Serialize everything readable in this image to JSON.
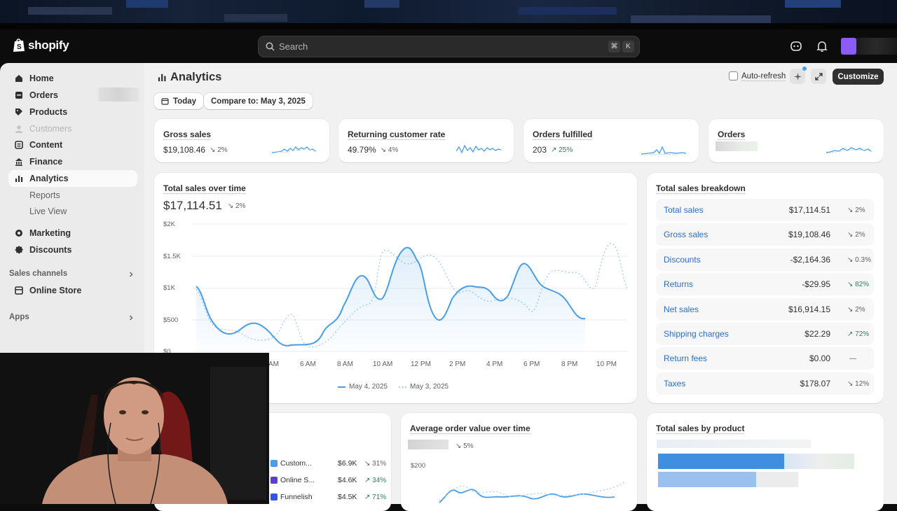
{
  "topbar": {
    "brand": "shopify",
    "search_placeholder": "Search",
    "shortcut_key1": "⌘",
    "shortcut_key2": "K"
  },
  "sidebar": {
    "items": [
      {
        "label": "Home",
        "icon": "home-icon"
      },
      {
        "label": "Orders",
        "icon": "orders-icon"
      },
      {
        "label": "Products",
        "icon": "products-icon"
      },
      {
        "label": "Customers",
        "icon": "customers-icon"
      },
      {
        "label": "Content",
        "icon": "content-icon"
      },
      {
        "label": "Finance",
        "icon": "finance-icon"
      },
      {
        "label": "Analytics",
        "icon": "analytics-icon"
      },
      {
        "label": "Reports"
      },
      {
        "label": "Live View"
      },
      {
        "label": "Marketing",
        "icon": "marketing-icon"
      },
      {
        "label": "Discounts",
        "icon": "discounts-icon"
      }
    ],
    "sales_channels_label": "Sales channels",
    "online_store_label": "Online Store",
    "apps_label": "Apps"
  },
  "header": {
    "title": "Analytics",
    "auto_refresh_label": "Auto-refresh",
    "customize_label": "Customize"
  },
  "filters": {
    "date_label": "Today",
    "compare_label": "Compare to: May 3, 2025"
  },
  "kpis": [
    {
      "title": "Gross sales",
      "value": "$19,108.46",
      "change": "2%",
      "direction": "down"
    },
    {
      "title": "Returning customer rate",
      "value": "49.79%",
      "change": "4%",
      "direction": "down"
    },
    {
      "title": "Orders fulfilled",
      "value": "203",
      "change": "25%",
      "direction": "up"
    },
    {
      "title": "Orders",
      "value": "",
      "change": "",
      "direction": ""
    }
  ],
  "sales_over_time": {
    "title": "Total sales over time",
    "value": "$17,114.51",
    "change": "2%",
    "legend_current": "May 4, 2025",
    "legend_previous": "May 3, 2025",
    "x_ticks": [
      "AM",
      "6 AM",
      "8 AM",
      "10 AM",
      "12 PM",
      "2 PM",
      "4 PM",
      "6 PM",
      "8 PM",
      "10 PM"
    ],
    "y_ticks": [
      "$2K",
      "$1.5K",
      "$1K",
      "$500",
      "$0"
    ]
  },
  "breakdown": {
    "title": "Total sales breakdown",
    "rows": [
      {
        "label": "Total sales",
        "amount": "$17,114.51",
        "change": "2%",
        "direction": "down"
      },
      {
        "label": "Gross sales",
        "amount": "$19,108.46",
        "change": "2%",
        "direction": "down"
      },
      {
        "label": "Discounts",
        "amount": "-$2,164.36",
        "change": "0.3%",
        "direction": "down"
      },
      {
        "label": "Returns",
        "amount": "-$29.95",
        "change": "82%",
        "direction": "down-good"
      },
      {
        "label": "Net sales",
        "amount": "$16,914.15",
        "change": "2%",
        "direction": "down"
      },
      {
        "label": "Shipping charges",
        "amount": "$22.29",
        "change": "72%",
        "direction": "up"
      },
      {
        "label": "Return fees",
        "amount": "$0.00",
        "change": "—",
        "direction": "none"
      },
      {
        "label": "Taxes",
        "amount": "$178.07",
        "change": "12%",
        "direction": "down"
      }
    ]
  },
  "channels": [
    {
      "label": "Custom...",
      "amount": "$6.9K",
      "change": "31%",
      "direction": "down",
      "color": "#4a9ee8"
    },
    {
      "label": "Online S...",
      "amount": "$4.6K",
      "change": "34%",
      "direction": "up",
      "color": "#5b3fd1"
    },
    {
      "label": "Funnelish",
      "amount": "$4.5K",
      "change": "71%",
      "direction": "up",
      "color": "#3558d6"
    }
  ],
  "aov": {
    "title": "Average order value over time",
    "change": "5%",
    "y_tick": "$200"
  },
  "by_product": {
    "title": "Total sales by product"
  },
  "colors": {
    "accent": "#4a9ee8",
    "link": "#2c6ecb",
    "positive": "#29845a"
  }
}
